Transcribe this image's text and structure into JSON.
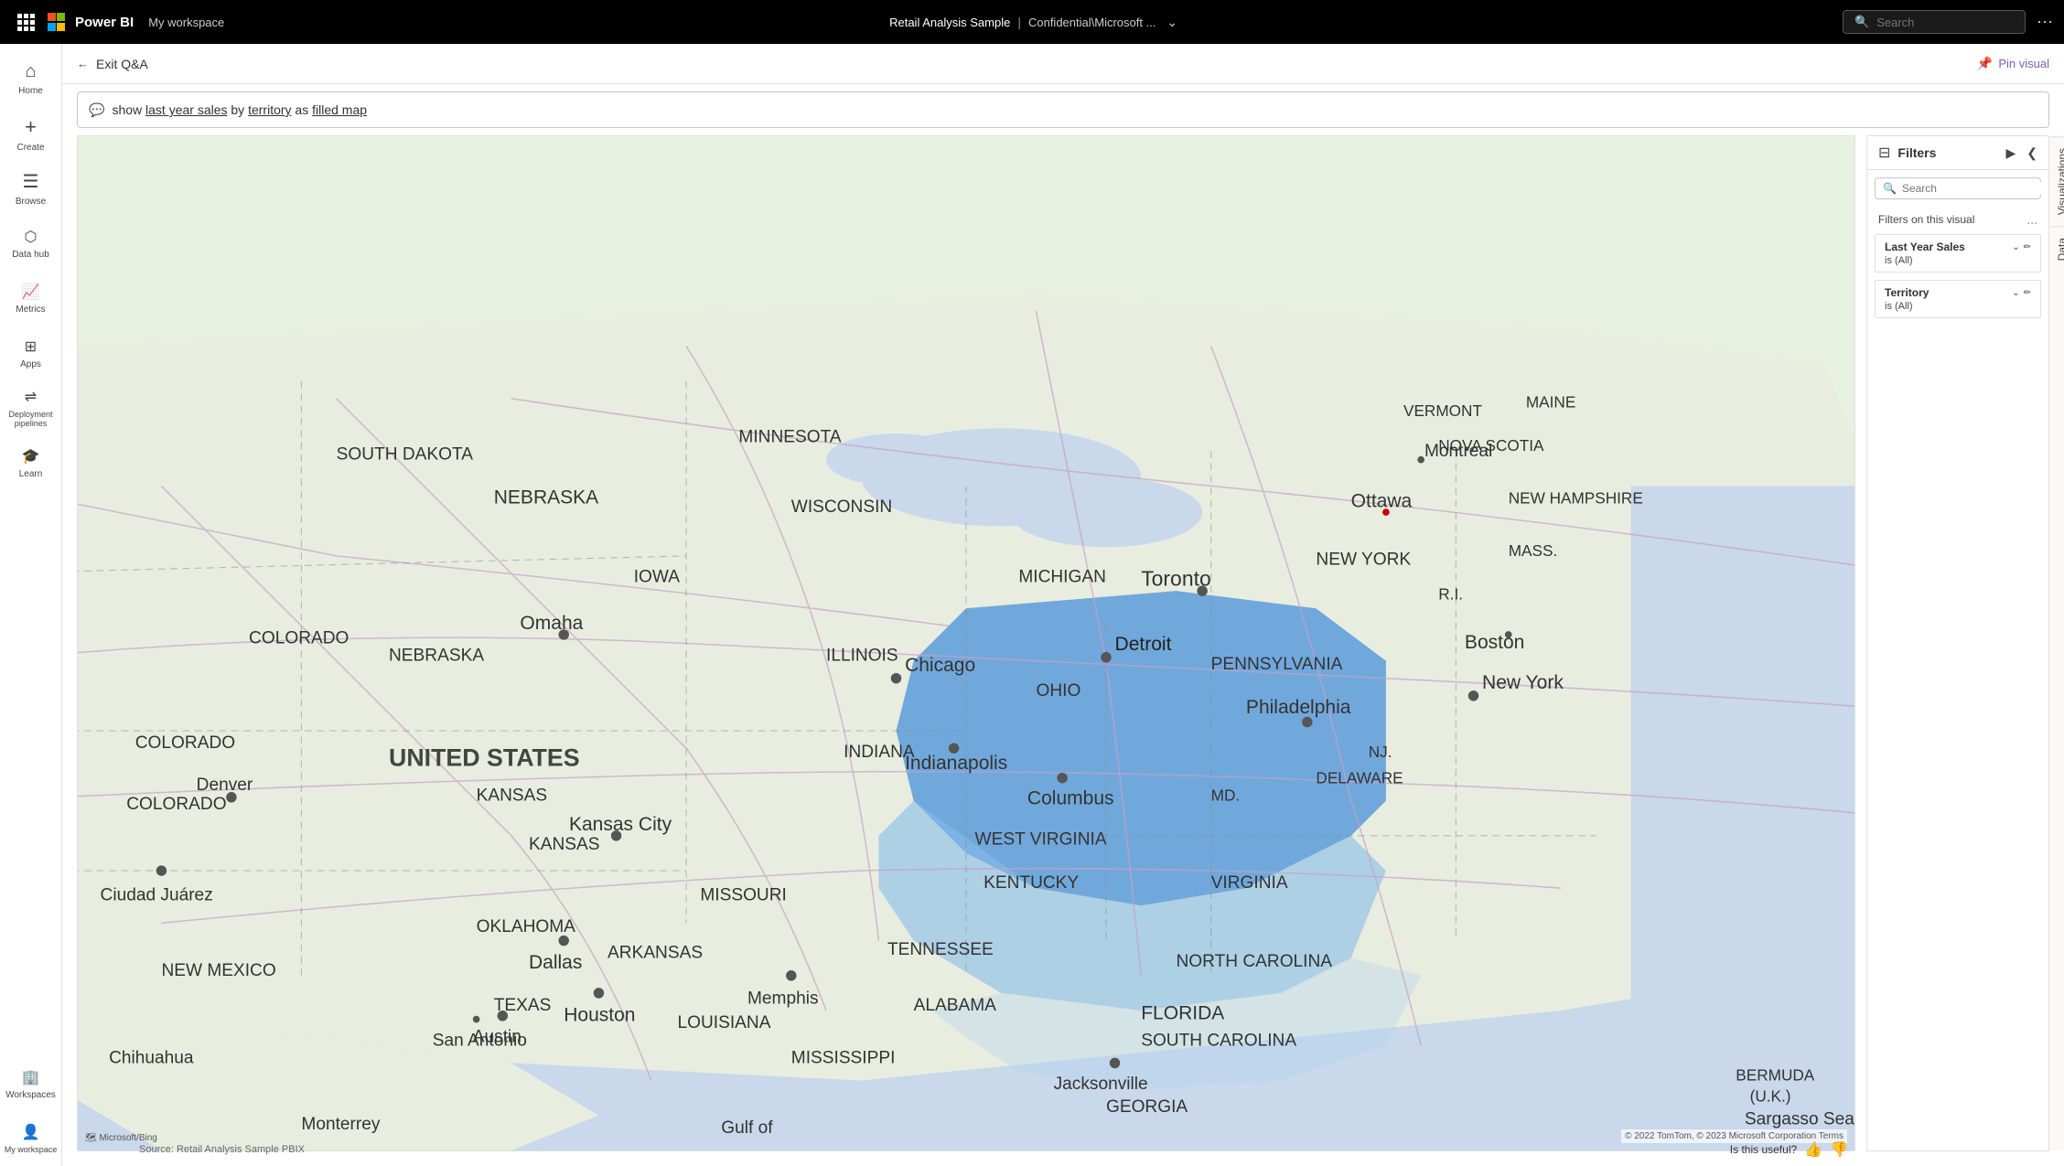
{
  "topNav": {
    "gridIconLabel": "Apps menu",
    "microsoftLabel": "Microsoft",
    "powerBILabel": "Power BI",
    "workspaceLabel": "My workspace",
    "reportTitle": "Retail Analysis Sample",
    "separator": "|",
    "confidential": "Confidential\\Microsoft ...",
    "searchPlaceholder": "Search",
    "moreLabel": "..."
  },
  "sidebar": {
    "items": [
      {
        "id": "home",
        "label": "Home",
        "icon": "⌂"
      },
      {
        "id": "create",
        "label": "Create",
        "icon": "+"
      },
      {
        "id": "browse",
        "label": "Browse",
        "icon": "☰"
      },
      {
        "id": "datahub",
        "label": "Data hub",
        "icon": "🗄"
      },
      {
        "id": "metrics",
        "label": "Metrics",
        "icon": "📊"
      },
      {
        "id": "apps",
        "label": "Apps",
        "icon": "⊞"
      },
      {
        "id": "deployment",
        "label": "Deployment pipelines",
        "icon": "🔀"
      },
      {
        "id": "learn",
        "label": "Learn",
        "icon": "🎓"
      },
      {
        "id": "workspaces",
        "label": "Workspaces",
        "icon": "🏢"
      },
      {
        "id": "myworkspace",
        "label": "My workspace",
        "icon": "👤"
      }
    ]
  },
  "subToolbar": {
    "exitQA": "Exit Q&A",
    "pinVisual": "Pin visual"
  },
  "qaBar": {
    "icon": "💬",
    "textParts": [
      "show ",
      "last year sales",
      " by ",
      "territory",
      " as ",
      "filled map"
    ]
  },
  "map": {
    "copyright": "© 2022 TomTom, © 2023 Microsoft Corporation  Terms",
    "logo": "🗺 Microsoft/Bing",
    "waterLabel": "Sargasso Sea",
    "gulfLabel": "Gulf of"
  },
  "filtersPanel": {
    "title": "Filters",
    "searchPlaceholder": "Search",
    "sectionLabel": "Filters on this visual",
    "moreBtn": "...",
    "filters": [
      {
        "name": "Last Year Sales",
        "value": "is (All)"
      },
      {
        "name": "Territory",
        "value": "is (All)"
      }
    ],
    "tabs": [
      "Visualizations",
      "Data"
    ]
  },
  "footer": {
    "sourceLabel": "Source: Retail Analysis Sample PBIX",
    "usefulLabel": "Is this useful?",
    "thumbUpLabel": "👍",
    "thumbDownLabel": "👎"
  }
}
